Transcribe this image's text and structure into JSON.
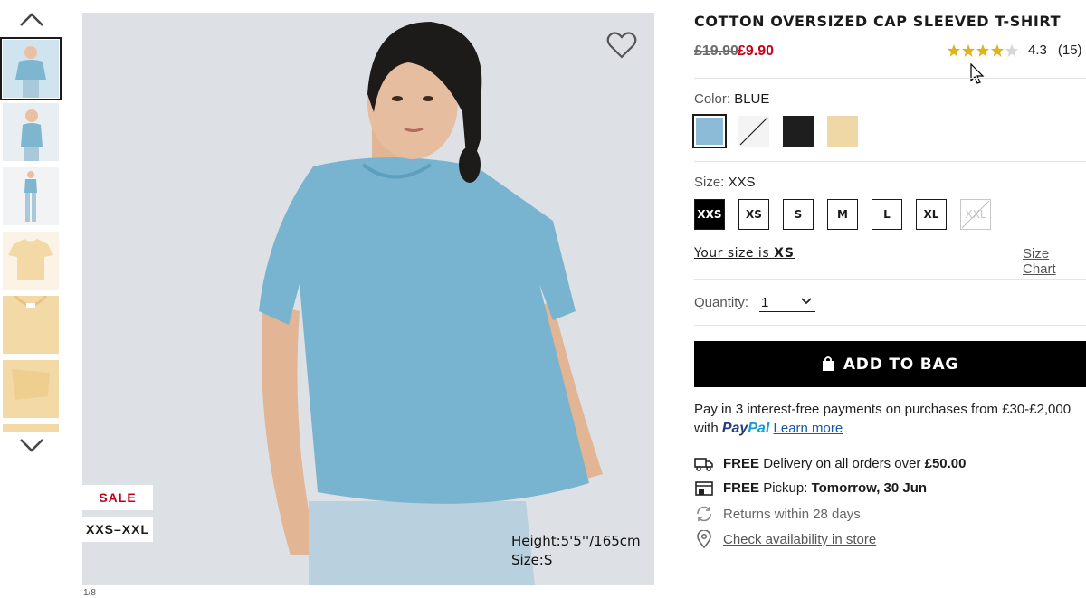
{
  "thumbnails": {
    "items": [
      {
        "name": "model-front",
        "bg": "#cfe4ef"
      },
      {
        "name": "model-side",
        "bg": "#e8eef2"
      },
      {
        "name": "model-full",
        "bg": "#f1f3f5"
      },
      {
        "name": "cream-flat",
        "bg": "#f3d9a6"
      },
      {
        "name": "cream-collar",
        "bg": "#f3d9a6"
      },
      {
        "name": "cream-sleeve",
        "bg": "#f3d9a6"
      }
    ],
    "counter": "1/8"
  },
  "main_image": {
    "badge_sale": "SALE",
    "badge_size": "XXS–XXL",
    "model_height": "Height:5'5''/165cm",
    "model_size": "Size:S"
  },
  "product": {
    "title": "COTTON OVERSIZED CAP SLEEVED T-SHIRT",
    "price_old": "£19.90",
    "price_new": "£9.90",
    "rating_score": "4.3",
    "rating_count": "(15)",
    "rating_value": 4.3
  },
  "color": {
    "label": "Color:",
    "value": "BLUE",
    "swatches": [
      {
        "name": "blue",
        "hex": "#8bbbd6"
      },
      {
        "name": "white",
        "hex": "#f4f4f4"
      },
      {
        "name": "black",
        "hex": "#1e1e1e"
      },
      {
        "name": "natural",
        "hex": "#f0d8a6"
      }
    ]
  },
  "size": {
    "label": "Size:",
    "value": "XXS",
    "options": [
      "XXS",
      "XS",
      "S",
      "M",
      "L",
      "XL",
      "XXL"
    ],
    "your_size_prefix": "Your size is",
    "your_size_value": "XS",
    "size_chart": "Size Chart"
  },
  "quantity": {
    "label": "Quantity:",
    "value": "1"
  },
  "cart": {
    "add_label": "ADD TO BAG"
  },
  "payment": {
    "line1": "Pay in 3 interest-free payments on purchases from £30-£2,000",
    "with": "with",
    "paypal_a": "Pay",
    "paypal_b": "Pal",
    "learn_more": "Learn more"
  },
  "info": {
    "delivery_free": "FREE",
    "delivery_text": "Delivery on all orders over",
    "delivery_amount": "£50.00",
    "pickup_free": "FREE",
    "pickup_text": "Pickup:",
    "pickup_date": "Tomorrow, 30 Jun",
    "returns": "Returns within 28 days",
    "availability": "Check availability in store"
  },
  "colors": {
    "sale_red": "#c70017",
    "star_gold": "#e3b21b",
    "button_black": "#000000"
  }
}
